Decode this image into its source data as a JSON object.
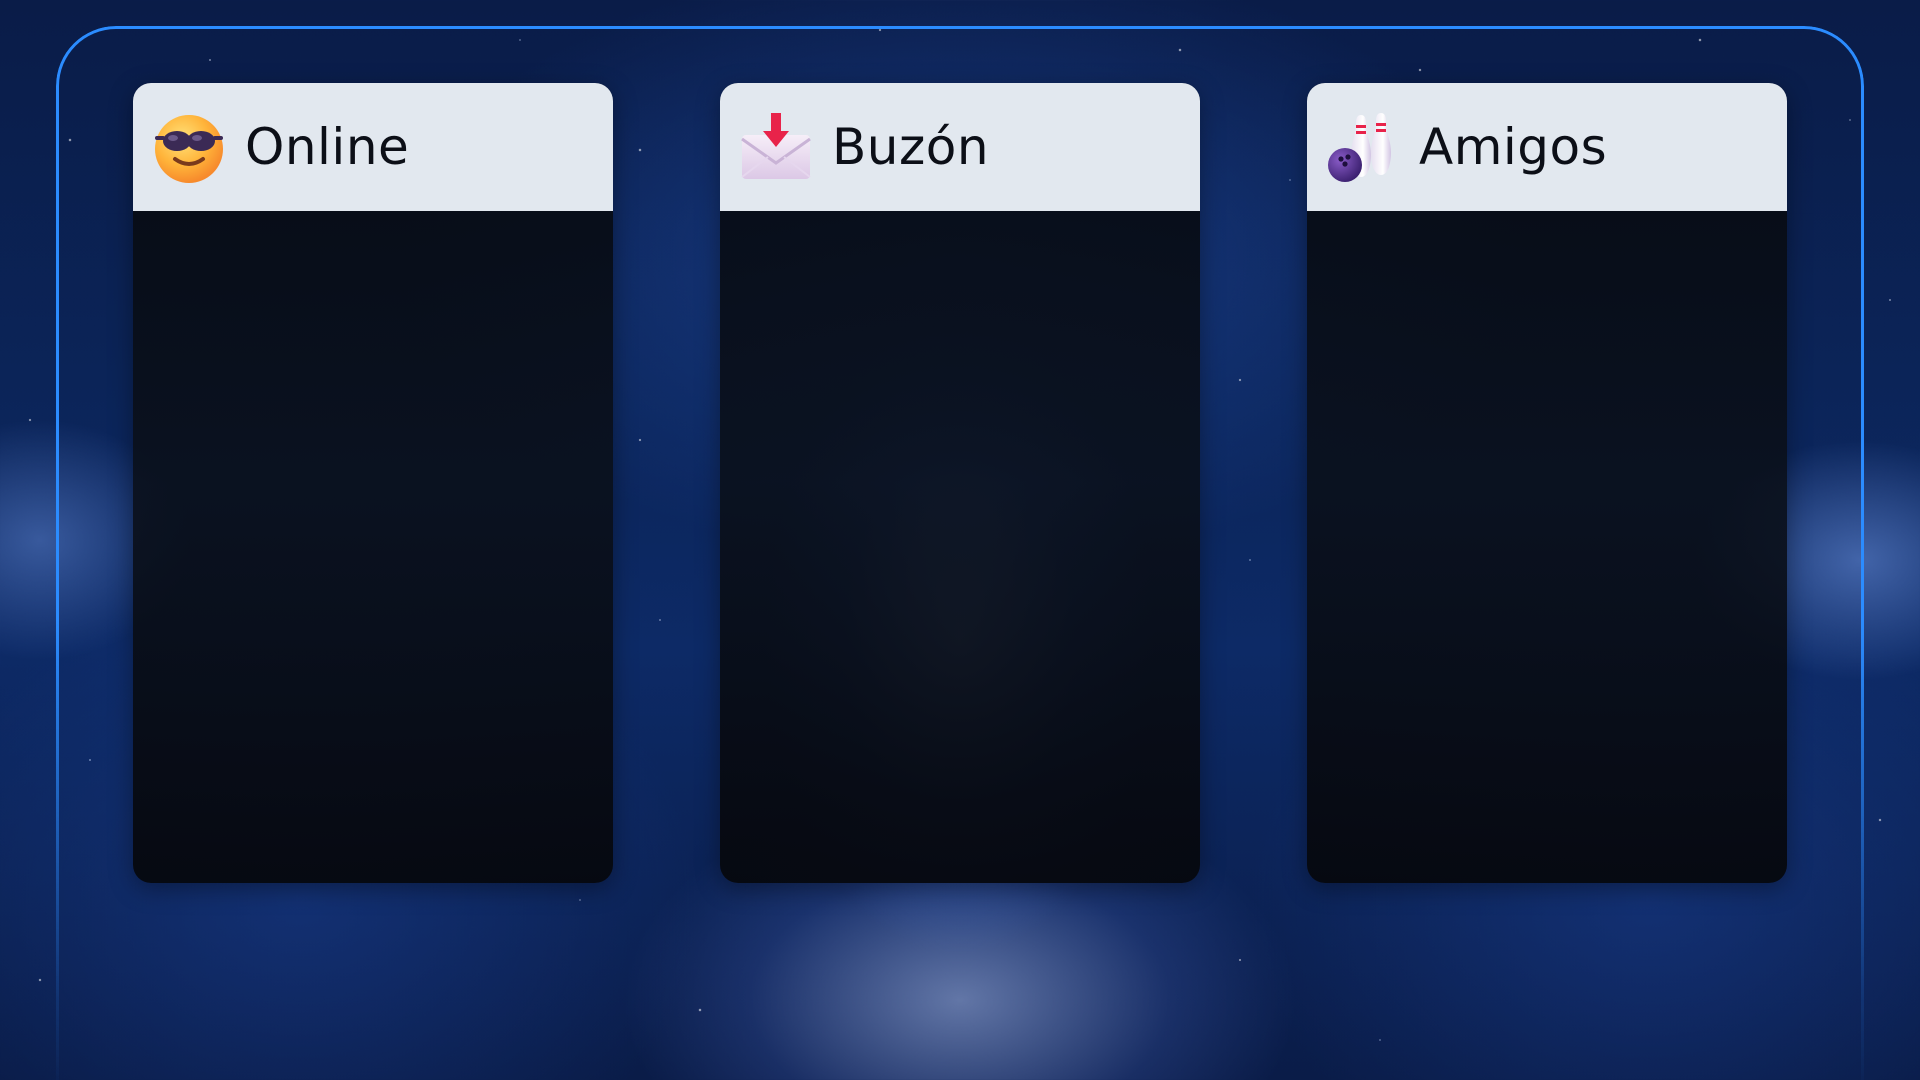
{
  "panels": [
    {
      "title": "Online",
      "icon": "smiling-face-with-sunglasses-icon"
    },
    {
      "title": "Buzón",
      "icon": "inbox-tray-envelope-icon"
    },
    {
      "title": "Amigos",
      "icon": "bowling-icon"
    }
  ],
  "colors": {
    "frame_border": "#2b8cff",
    "header_background": "#e2e8ef",
    "title_text": "#0c0f17",
    "panel_body": "#0a0f18"
  }
}
